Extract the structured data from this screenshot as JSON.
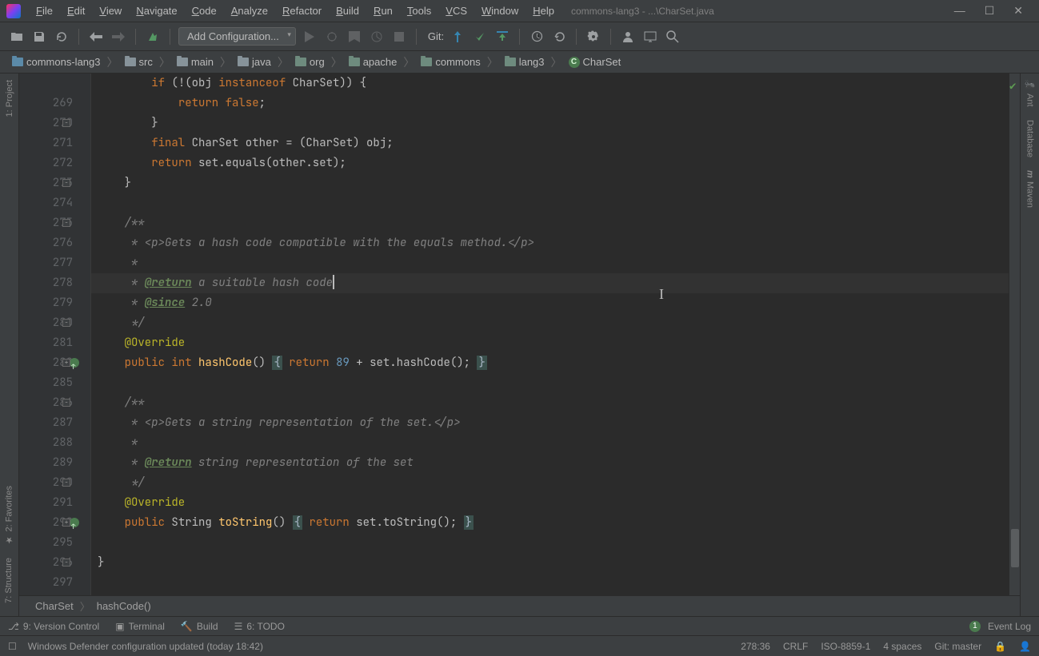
{
  "window": {
    "path": "commons-lang3 - ...\\CharSet.java"
  },
  "menu": [
    "File",
    "Edit",
    "View",
    "Navigate",
    "Code",
    "Analyze",
    "Refactor",
    "Build",
    "Run",
    "Tools",
    "VCS",
    "Window",
    "Help"
  ],
  "toolbar": {
    "config_label": "Add Configuration...",
    "git_label": "Git:"
  },
  "breadcrumbs": [
    {
      "icon": "mod",
      "label": "commons-lang3"
    },
    {
      "icon": "folder",
      "label": "src"
    },
    {
      "icon": "folder",
      "label": "main"
    },
    {
      "icon": "folder",
      "label": "java"
    },
    {
      "icon": "pkg",
      "label": "org"
    },
    {
      "icon": "pkg",
      "label": "apache"
    },
    {
      "icon": "pkg",
      "label": "commons"
    },
    {
      "icon": "pkg",
      "label": "lang3"
    },
    {
      "icon": "class",
      "label": "CharSet"
    }
  ],
  "left_tools": [
    {
      "label": "1: Project"
    },
    {
      "label": "2: Favorites"
    },
    {
      "label": "7: Structure"
    }
  ],
  "right_tools": [
    {
      "label": "Ant"
    },
    {
      "label": "Database"
    },
    {
      "label": "Maven"
    }
  ],
  "editor": {
    "crumb_class": "CharSet",
    "crumb_method": "hashCode()",
    "lines": [
      {
        "n": "",
        "cls": "",
        "html": "        <span class='kw'>if</span> (!(obj <span class='kw'>instanceof</span> CharSet)) {"
      },
      {
        "n": "269",
        "cls": "",
        "html": "            <span class='kw'>return false</span>;"
      },
      {
        "n": "270",
        "cls": "",
        "html": "        }",
        "fold": "-"
      },
      {
        "n": "271",
        "cls": "",
        "html": "        <span class='kw'>final</span> CharSet other = (CharSet) obj;"
      },
      {
        "n": "272",
        "cls": "",
        "html": "        <span class='kw'>return</span> set.equals(other.set);"
      },
      {
        "n": "273",
        "cls": "",
        "html": "    }",
        "fold": "-"
      },
      {
        "n": "274",
        "cls": "",
        "html": ""
      },
      {
        "n": "275",
        "cls": "",
        "html": "    <span class='com'>/**</span>",
        "fold": "-"
      },
      {
        "n": "276",
        "cls": "",
        "html": "    <span class='com'> * &lt;p&gt;Gets a hash code compatible with the equals method.&lt;/p&gt;</span>"
      },
      {
        "n": "277",
        "cls": "",
        "html": "    <span class='com'> *</span>"
      },
      {
        "n": "278",
        "cls": "current",
        "html": "    <span class='com'> * <span class='doctag'>@return</span> a suitable hash code</span><span class='caret'></span>"
      },
      {
        "n": "279",
        "cls": "",
        "html": "    <span class='com'> * <span class='doctag'>@since</span> 2.0</span>"
      },
      {
        "n": "280",
        "cls": "",
        "html": "    <span class='com'> */</span>",
        "fold": "-"
      },
      {
        "n": "281",
        "cls": "",
        "html": "    <span class='ann'>@Override</span>"
      },
      {
        "n": "282",
        "cls": "",
        "html": "    <span class='kw'>public</span> <span class='kw'>int</span> <span class='method'>hashCode</span>() <span class='fold-region'>{</span> <span class='kw'>return</span> <span class='num'>89</span> + set.hashCode(); <span class='fold-region'>}</span>",
        "override": true,
        "fold": "+"
      },
      {
        "n": "285",
        "cls": "",
        "html": ""
      },
      {
        "n": "286",
        "cls": "",
        "html": "    <span class='com'>/**</span>",
        "fold": "-"
      },
      {
        "n": "287",
        "cls": "",
        "html": "    <span class='com'> * &lt;p&gt;Gets a string representation of the set.&lt;/p&gt;</span>"
      },
      {
        "n": "288",
        "cls": "",
        "html": "    <span class='com'> *</span>"
      },
      {
        "n": "289",
        "cls": "",
        "html": "    <span class='com'> * <span class='doctag'>@return</span> string representation of the set</span>"
      },
      {
        "n": "290",
        "cls": "",
        "html": "    <span class='com'> */</span>",
        "fold": "-"
      },
      {
        "n": "291",
        "cls": "",
        "html": "    <span class='ann'>@Override</span>"
      },
      {
        "n": "292",
        "cls": "",
        "html": "    <span class='kw'>public</span> String <span class='method'>toString</span>() <span class='fold-region'>{</span> <span class='kw'>return</span> set.toString(); <span class='fold-region'>}</span>",
        "override": true,
        "fold": "+"
      },
      {
        "n": "295",
        "cls": "",
        "html": ""
      },
      {
        "n": "296",
        "cls": "",
        "html": "}",
        "fold": "-"
      },
      {
        "n": "297",
        "cls": "",
        "html": ""
      }
    ]
  },
  "bottom_tools": [
    {
      "label": "9: Version Control",
      "u": "9"
    },
    {
      "label": "Terminal"
    },
    {
      "label": "Build"
    },
    {
      "label": "6: TODO",
      "u": "6"
    }
  ],
  "event_log": {
    "count": "1",
    "label": "Event Log"
  },
  "status": {
    "msg": "Windows Defender configuration updated (today 18:42)",
    "pos": "278:36",
    "eol": "CRLF",
    "enc": "ISO-8859-1",
    "indent": "4 spaces",
    "git": "Git: master"
  }
}
